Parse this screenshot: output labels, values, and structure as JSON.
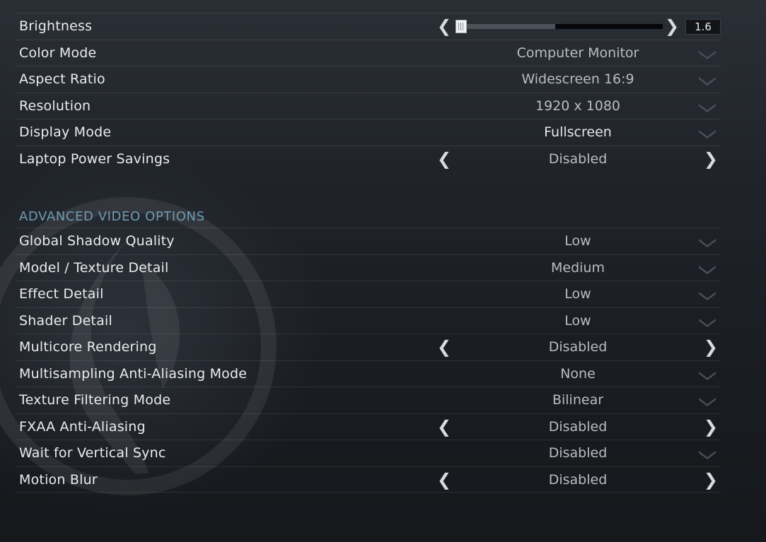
{
  "settings": [
    {
      "label": "Brightness",
      "type": "slider",
      "value": "1.6",
      "fill_fraction": 0.48
    },
    {
      "label": "Color Mode",
      "type": "dropdown",
      "value": "Computer Monitor"
    },
    {
      "label": "Aspect Ratio",
      "type": "dropdown",
      "value": "Widescreen 16:9"
    },
    {
      "label": "Resolution",
      "type": "dropdown",
      "value": "1920 x 1080"
    },
    {
      "label": "Display Mode",
      "type": "dropdown",
      "value": "Fullscreen"
    },
    {
      "label": "Laptop Power Savings",
      "type": "toggle",
      "value": "Disabled"
    }
  ],
  "advanced": {
    "title": "ADVANCED VIDEO OPTIONS",
    "settings": [
      {
        "label": "Global Shadow Quality",
        "type": "dropdown",
        "value": "Low"
      },
      {
        "label": "Model / Texture Detail",
        "type": "dropdown",
        "value": "Medium"
      },
      {
        "label": "Effect Detail",
        "type": "dropdown",
        "value": "Low"
      },
      {
        "label": "Shader Detail",
        "type": "dropdown",
        "value": "Low"
      },
      {
        "label": "Multicore Rendering",
        "type": "toggle",
        "value": "Disabled"
      },
      {
        "label": "Multisampling Anti-Aliasing Mode",
        "type": "dropdown",
        "value": "None"
      },
      {
        "label": "Texture Filtering Mode",
        "type": "dropdown",
        "value": "Bilinear"
      },
      {
        "label": "FXAA Anti-Aliasing",
        "type": "toggle",
        "value": "Disabled"
      },
      {
        "label": "Wait for Vertical Sync",
        "type": "dropdown",
        "value": "Disabled"
      },
      {
        "label": "Motion Blur",
        "type": "toggle",
        "value": "Disabled"
      }
    ]
  },
  "icons": {
    "dropdown": "chevron-down-icon",
    "prev": "arrow-left-icon",
    "next": "arrow-right-icon",
    "prev_glyph": "❮",
    "next_glyph": "❯"
  },
  "colors": {
    "section_title": "#6f9bb4",
    "label": "#e9ecef",
    "value": "#b9bdc3"
  }
}
